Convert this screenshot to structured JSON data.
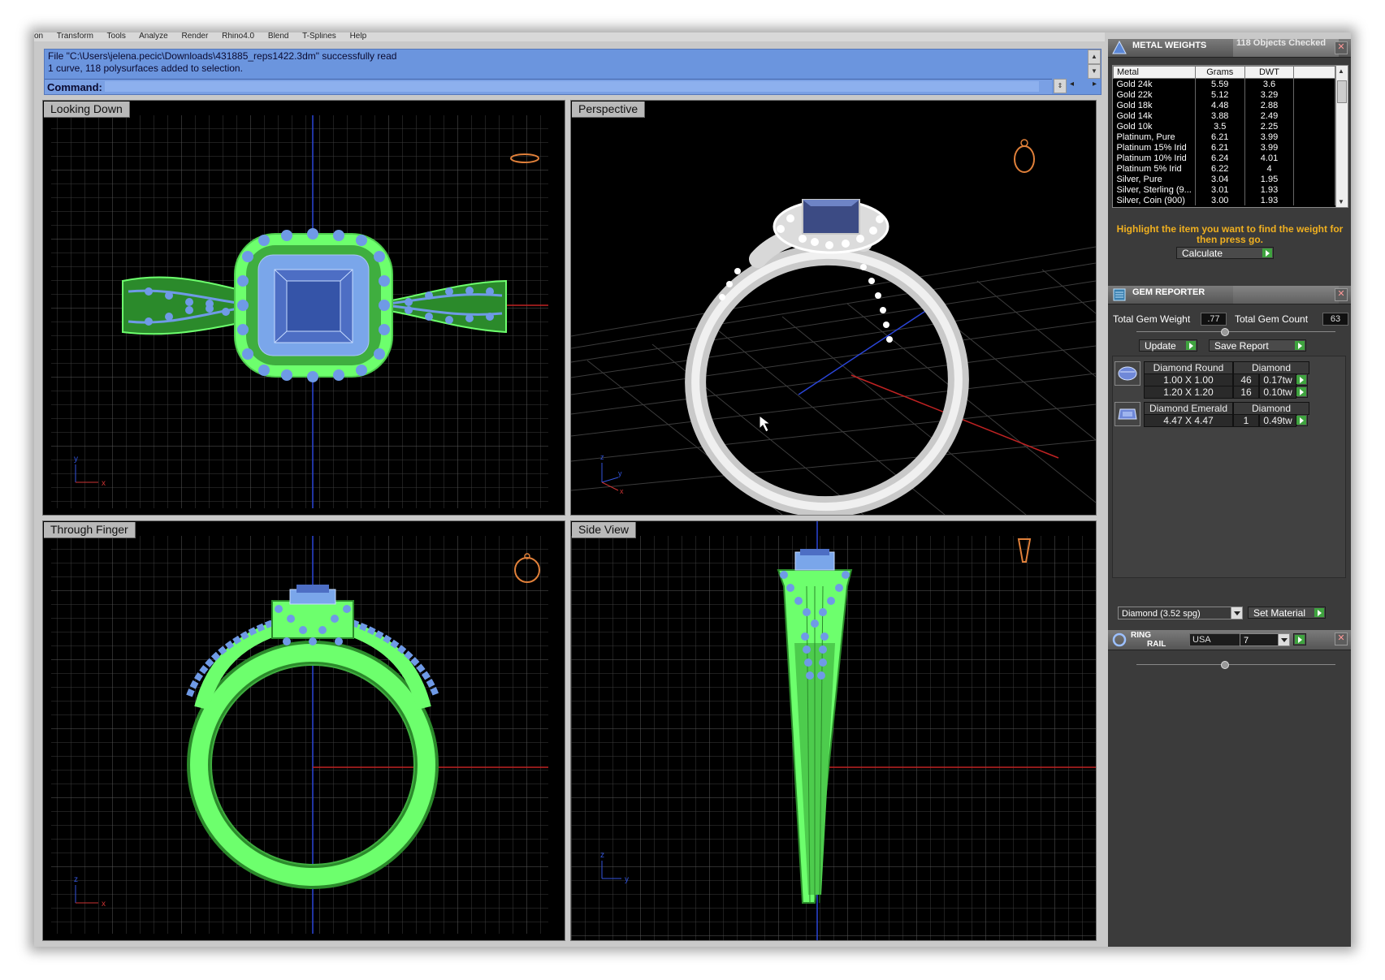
{
  "menu": [
    "on",
    "Transform",
    "Tools",
    "Analyze",
    "Render",
    "Rhino4.0",
    "Blend",
    "T-Splines",
    "Help"
  ],
  "command": {
    "line1": "File \"C:\\Users\\jelena.pecic\\Downloads\\431885_reps1422.3dm\" successfully read",
    "line2": "1 curve, 118 polysurfaces added to selection.",
    "label": "Command:",
    "value": ""
  },
  "viewports": {
    "top_left": "Looking Down",
    "top_right": "Perspective",
    "bottom_left": "Through Finger",
    "bottom_right": "Side View"
  },
  "metal_weights": {
    "title": "METAL WEIGHTS",
    "status": "118 Objects Checked",
    "columns": [
      "Metal",
      "Grams",
      "DWT"
    ],
    "rows": [
      {
        "metal": "Gold 24k",
        "grams": "5.59",
        "dwt": "3.6"
      },
      {
        "metal": "Gold 22k",
        "grams": "5.12",
        "dwt": "3.29"
      },
      {
        "metal": "Gold 18k",
        "grams": "4.48",
        "dwt": "2.88"
      },
      {
        "metal": "Gold 14k",
        "grams": "3.88",
        "dwt": "2.49"
      },
      {
        "metal": "Gold 10k",
        "grams": "3.5",
        "dwt": "2.25"
      },
      {
        "metal": "Platinum, Pure",
        "grams": "6.21",
        "dwt": "3.99"
      },
      {
        "metal": "Platinum 15% Irid",
        "grams": "6.21",
        "dwt": "3.99"
      },
      {
        "metal": "Platinum 10% Irid",
        "grams": "6.24",
        "dwt": "4.01"
      },
      {
        "metal": "Platinum 5% Irid",
        "grams": "6.22",
        "dwt": "4"
      },
      {
        "metal": "Silver, Pure",
        "grams": "3.04",
        "dwt": "1.95"
      },
      {
        "metal": "Silver, Sterling (9...",
        "grams": "3.01",
        "dwt": "1.93"
      },
      {
        "metal": "Silver, Coin (900)",
        "grams": "3.00",
        "dwt": "1.93"
      }
    ],
    "instruction": "Highlight the item you want to find the weight for then press go.",
    "calculate_label": "Calculate"
  },
  "gem_reporter": {
    "title": "GEM REPORTER",
    "total_weight_label": "Total Gem Weight",
    "total_weight": ".77",
    "total_count_label": "Total Gem Count",
    "total_count": "63",
    "update_label": "Update",
    "save_label": "Save Report",
    "gems": [
      {
        "shape": "Diamond Round",
        "material": "Diamond",
        "sizes": [
          {
            "size": "1.00 X 1.00",
            "count": "46",
            "weight": "0.17tw"
          },
          {
            "size": "1.20 X 1.20",
            "count": "16",
            "weight": "0.10tw"
          }
        ]
      },
      {
        "shape": "Diamond Emerald",
        "material": "Diamond",
        "sizes": [
          {
            "size": "4.47 X 4.47",
            "count": "1",
            "weight": "0.49tw"
          }
        ]
      }
    ],
    "material_select": "Diamond     (3.52 spg)",
    "set_material_label": "Set Material"
  },
  "ring_rail": {
    "title_line1": "RING",
    "title_line2": "RAIL",
    "region": "USA",
    "size": "7"
  },
  "colors": {
    "wireframe": "#6dff6d",
    "gems": "#6f9ae6",
    "command_bg": "#6b95de",
    "note": "#f0b020"
  }
}
